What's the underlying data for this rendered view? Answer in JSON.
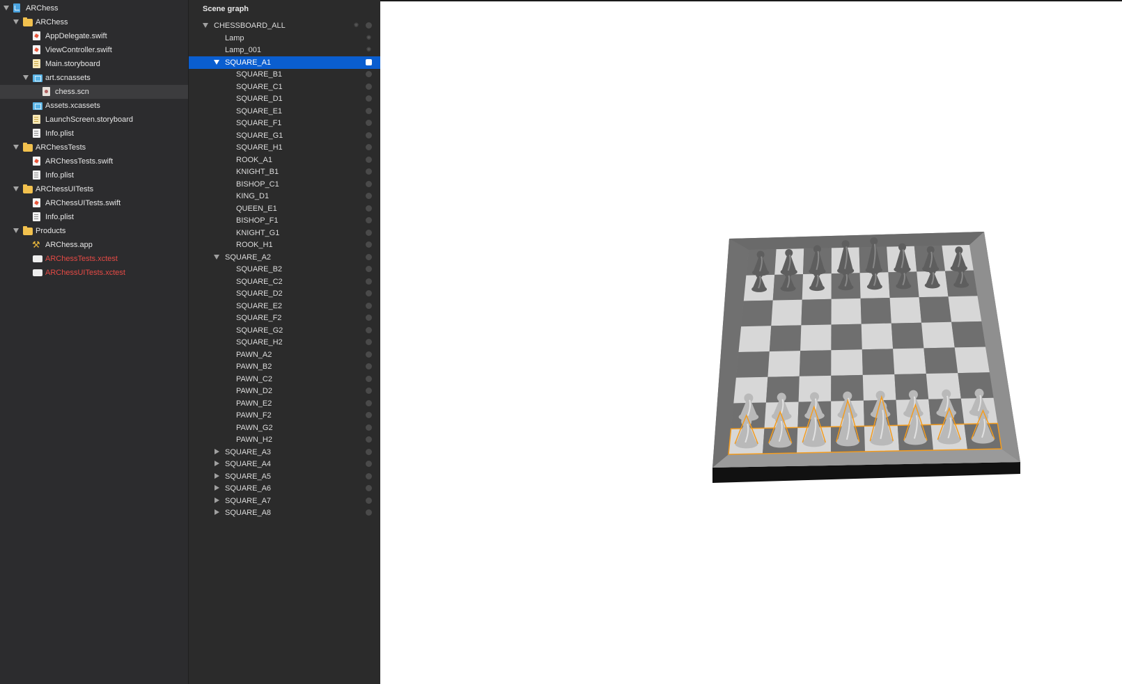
{
  "navigator": {
    "items": [
      {
        "label": "ARChess",
        "icon": "project-icon",
        "depth": 0,
        "disclosure": "open",
        "selected": false,
        "red": false
      },
      {
        "label": "ARChess",
        "icon": "folder-icon",
        "depth": 1,
        "disclosure": "open",
        "selected": false,
        "red": false
      },
      {
        "label": "AppDelegate.swift",
        "icon": "swift-file-icon",
        "depth": 2,
        "disclosure": "none",
        "selected": false,
        "red": false
      },
      {
        "label": "ViewController.swift",
        "icon": "swift-file-icon",
        "depth": 2,
        "disclosure": "none",
        "selected": false,
        "red": false
      },
      {
        "label": "Main.storyboard",
        "icon": "storyboard-file-icon",
        "depth": 2,
        "disclosure": "none",
        "selected": false,
        "red": false
      },
      {
        "label": "art.scnassets",
        "icon": "asset-folder-icon",
        "depth": 2,
        "disclosure": "open",
        "selected": false,
        "red": false
      },
      {
        "label": "chess.scn",
        "icon": "scene-file-icon",
        "depth": 3,
        "disclosure": "none",
        "selected": true,
        "red": false
      },
      {
        "label": "Assets.xcassets",
        "icon": "asset-catalog-icon",
        "depth": 2,
        "disclosure": "none",
        "selected": false,
        "red": false
      },
      {
        "label": "LaunchScreen.storyboard",
        "icon": "storyboard-file-icon",
        "depth": 2,
        "disclosure": "none",
        "selected": false,
        "red": false
      },
      {
        "label": "Info.plist",
        "icon": "plist-file-icon",
        "depth": 2,
        "disclosure": "none",
        "selected": false,
        "red": false
      },
      {
        "label": "ARChessTests",
        "icon": "folder-icon",
        "depth": 1,
        "disclosure": "open",
        "selected": false,
        "red": false
      },
      {
        "label": "ARChessTests.swift",
        "icon": "swift-file-icon",
        "depth": 2,
        "disclosure": "none",
        "selected": false,
        "red": false
      },
      {
        "label": "Info.plist",
        "icon": "plist-file-icon",
        "depth": 2,
        "disclosure": "none",
        "selected": false,
        "red": false
      },
      {
        "label": "ARChessUITests",
        "icon": "folder-icon",
        "depth": 1,
        "disclosure": "open",
        "selected": false,
        "red": false
      },
      {
        "label": "ARChessUITests.swift",
        "icon": "swift-file-icon",
        "depth": 2,
        "disclosure": "none",
        "selected": false,
        "red": false
      },
      {
        "label": "Info.plist",
        "icon": "plist-file-icon",
        "depth": 2,
        "disclosure": "none",
        "selected": false,
        "red": false
      },
      {
        "label": "Products",
        "icon": "folder-icon",
        "depth": 1,
        "disclosure": "open",
        "selected": false,
        "red": false
      },
      {
        "label": "ARChess.app",
        "icon": "app-product-icon",
        "depth": 2,
        "disclosure": "none",
        "selected": false,
        "red": false
      },
      {
        "label": "ARChessTests.xctest",
        "icon": "xctest-bundle-icon",
        "depth": 2,
        "disclosure": "none",
        "selected": false,
        "red": true
      },
      {
        "label": "ARChessUITests.xctest",
        "icon": "xctest-bundle-icon",
        "depth": 2,
        "disclosure": "none",
        "selected": false,
        "red": true
      }
    ]
  },
  "scene_graph": {
    "title": "Scene graph",
    "nodes": [
      {
        "label": "CHESSBOARD_ALL",
        "depth": 0,
        "disclosure": "open",
        "selected": false,
        "kind": "node"
      },
      {
        "label": "Lamp",
        "depth": 1,
        "disclosure": "none",
        "selected": false,
        "kind": "light"
      },
      {
        "label": "Lamp_001",
        "depth": 1,
        "disclosure": "none",
        "selected": false,
        "kind": "light"
      },
      {
        "label": "SQUARE_A1",
        "depth": 1,
        "disclosure": "open",
        "selected": true,
        "kind": "geometry"
      },
      {
        "label": "SQUARE_B1",
        "depth": 2,
        "disclosure": "none",
        "selected": false,
        "kind": "geometry"
      },
      {
        "label": "SQUARE_C1",
        "depth": 2,
        "disclosure": "none",
        "selected": false,
        "kind": "geometry"
      },
      {
        "label": "SQUARE_D1",
        "depth": 2,
        "disclosure": "none",
        "selected": false,
        "kind": "geometry"
      },
      {
        "label": "SQUARE_E1",
        "depth": 2,
        "disclosure": "none",
        "selected": false,
        "kind": "geometry"
      },
      {
        "label": "SQUARE_F1",
        "depth": 2,
        "disclosure": "none",
        "selected": false,
        "kind": "geometry"
      },
      {
        "label": "SQUARE_G1",
        "depth": 2,
        "disclosure": "none",
        "selected": false,
        "kind": "geometry"
      },
      {
        "label": "SQUARE_H1",
        "depth": 2,
        "disclosure": "none",
        "selected": false,
        "kind": "geometry"
      },
      {
        "label": "ROOK_A1",
        "depth": 2,
        "disclosure": "none",
        "selected": false,
        "kind": "geometry"
      },
      {
        "label": "KNIGHT_B1",
        "depth": 2,
        "disclosure": "none",
        "selected": false,
        "kind": "geometry"
      },
      {
        "label": "BISHOP_C1",
        "depth": 2,
        "disclosure": "none",
        "selected": false,
        "kind": "geometry"
      },
      {
        "label": "KING_D1",
        "depth": 2,
        "disclosure": "none",
        "selected": false,
        "kind": "geometry"
      },
      {
        "label": "QUEEN_E1",
        "depth": 2,
        "disclosure": "none",
        "selected": false,
        "kind": "geometry"
      },
      {
        "label": "BISHOP_F1",
        "depth": 2,
        "disclosure": "none",
        "selected": false,
        "kind": "geometry"
      },
      {
        "label": "KNIGHT_G1",
        "depth": 2,
        "disclosure": "none",
        "selected": false,
        "kind": "geometry"
      },
      {
        "label": "ROOK_H1",
        "depth": 2,
        "disclosure": "none",
        "selected": false,
        "kind": "geometry"
      },
      {
        "label": "SQUARE_A2",
        "depth": 1,
        "disclosure": "open",
        "selected": false,
        "kind": "geometry"
      },
      {
        "label": "SQUARE_B2",
        "depth": 2,
        "disclosure": "none",
        "selected": false,
        "kind": "geometry"
      },
      {
        "label": "SQUARE_C2",
        "depth": 2,
        "disclosure": "none",
        "selected": false,
        "kind": "geometry"
      },
      {
        "label": "SQUARE_D2",
        "depth": 2,
        "disclosure": "none",
        "selected": false,
        "kind": "geometry"
      },
      {
        "label": "SQUARE_E2",
        "depth": 2,
        "disclosure": "none",
        "selected": false,
        "kind": "geometry"
      },
      {
        "label": "SQUARE_F2",
        "depth": 2,
        "disclosure": "none",
        "selected": false,
        "kind": "geometry"
      },
      {
        "label": "SQUARE_G2",
        "depth": 2,
        "disclosure": "none",
        "selected": false,
        "kind": "geometry"
      },
      {
        "label": "SQUARE_H2",
        "depth": 2,
        "disclosure": "none",
        "selected": false,
        "kind": "geometry"
      },
      {
        "label": "PAWN_A2",
        "depth": 2,
        "disclosure": "none",
        "selected": false,
        "kind": "geometry"
      },
      {
        "label": "PAWN_B2",
        "depth": 2,
        "disclosure": "none",
        "selected": false,
        "kind": "geometry"
      },
      {
        "label": "PAWN_C2",
        "depth": 2,
        "disclosure": "none",
        "selected": false,
        "kind": "geometry"
      },
      {
        "label": "PAWN_D2",
        "depth": 2,
        "disclosure": "none",
        "selected": false,
        "kind": "geometry"
      },
      {
        "label": "PAWN_E2",
        "depth": 2,
        "disclosure": "none",
        "selected": false,
        "kind": "geometry"
      },
      {
        "label": "PAWN_F2",
        "depth": 2,
        "disclosure": "none",
        "selected": false,
        "kind": "geometry"
      },
      {
        "label": "PAWN_G2",
        "depth": 2,
        "disclosure": "none",
        "selected": false,
        "kind": "geometry"
      },
      {
        "label": "PAWN_H2",
        "depth": 2,
        "disclosure": "none",
        "selected": false,
        "kind": "geometry"
      },
      {
        "label": "SQUARE_A3",
        "depth": 1,
        "disclosure": "closed",
        "selected": false,
        "kind": "geometry"
      },
      {
        "label": "SQUARE_A4",
        "depth": 1,
        "disclosure": "closed",
        "selected": false,
        "kind": "geometry"
      },
      {
        "label": "SQUARE_A5",
        "depth": 1,
        "disclosure": "closed",
        "selected": false,
        "kind": "geometry"
      },
      {
        "label": "SQUARE_A6",
        "depth": 1,
        "disclosure": "closed",
        "selected": false,
        "kind": "geometry"
      },
      {
        "label": "SQUARE_A7",
        "depth": 1,
        "disclosure": "closed",
        "selected": false,
        "kind": "geometry"
      },
      {
        "label": "SQUARE_A8",
        "depth": 1,
        "disclosure": "closed",
        "selected": false,
        "kind": "geometry"
      }
    ]
  },
  "viewport": {
    "scene": "chessboard-3d-render",
    "selection_color": "#f39c1f",
    "light_square_color": "#d7d7d7",
    "dark_square_color": "#6f6f6f",
    "frame_color": "#7d7d7d",
    "piece_color": "#8a8a8a"
  },
  "colors": {
    "navigator_bg": "#2c2c2e",
    "scene_graph_bg": "#2b2b2b",
    "selection_blue": "#0a5ed0",
    "missing_file_red": "#e64a45"
  }
}
